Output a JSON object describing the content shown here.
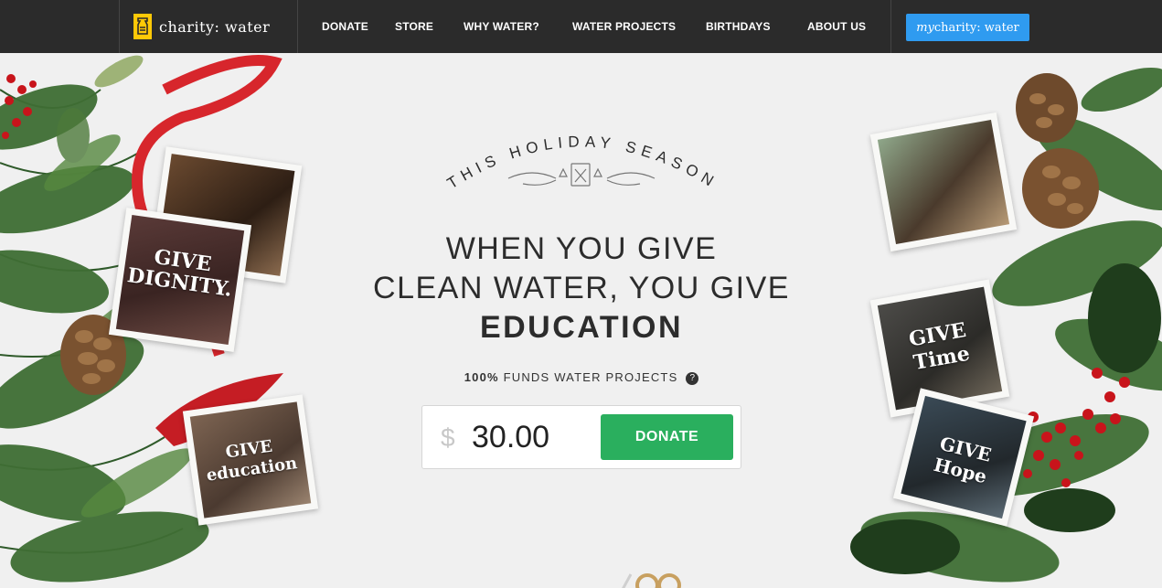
{
  "nav": {
    "logo_text": "charity: water",
    "links": [
      "DONATE",
      "STORE",
      "WHY WATER?",
      "WATER PROJECTS",
      "BIRTHDAYS",
      "ABOUT US"
    ],
    "mycharity_prefix": "my",
    "mycharity_suffix": "charity: water"
  },
  "hero": {
    "arc_title": "THIS HOLIDAY SEASON",
    "headline_line1": "WHEN YOU GIVE",
    "headline_line2": "CLEAN WATER, YOU GIVE",
    "headline_line3": "EDUCATION",
    "funds_bold": "100%",
    "funds_text": "FUNDS WATER PROJECTS",
    "help_icon": "?",
    "currency": "$",
    "amount": "30.00",
    "donate_label": "DONATE"
  },
  "photos": {
    "dignity": "GIVE DIGNITY.",
    "education": "GIVE education",
    "time": "GIVE Time",
    "hope": "GIVE Hope"
  },
  "colors": {
    "nav_bg": "#2b2b2b",
    "brand_yellow": "#ffc907",
    "mycharity_blue": "#2f9bf0",
    "donate_green": "#2aaf5e"
  }
}
